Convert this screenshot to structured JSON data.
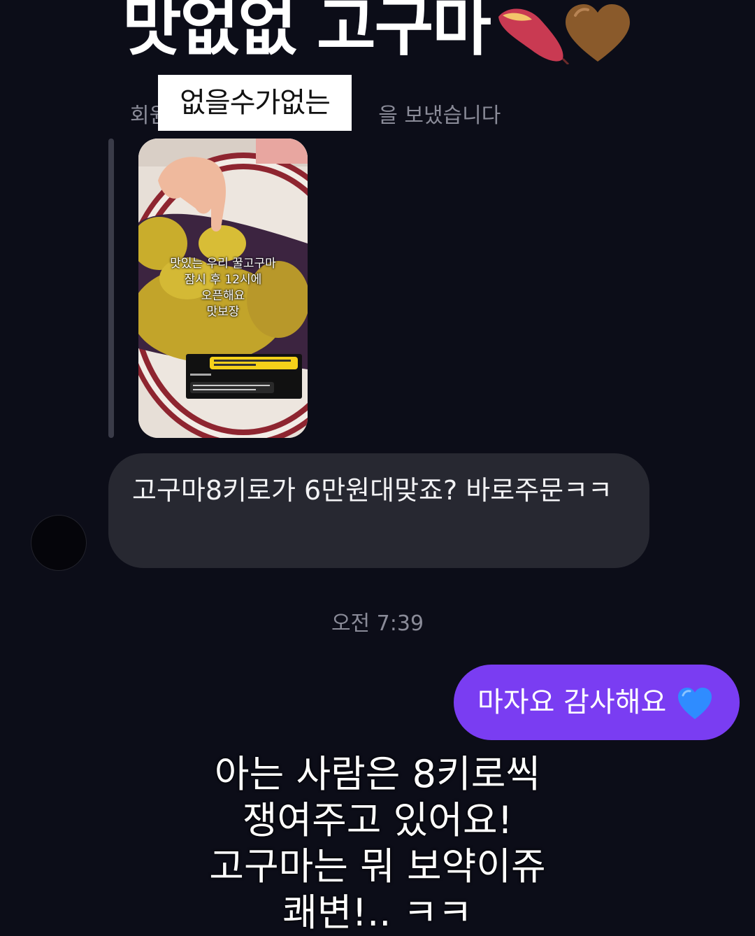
{
  "story_overlay": {
    "title": "맛없없 고구마",
    "sticker": "없을수가없는"
  },
  "reply": {
    "header_start": "회원",
    "header_end": "을 보냈습니다",
    "shared_story_text": [
      "맛있는 우리 꿀고구마",
      "잠시 후 12시에",
      "오픈해요",
      "맛보장"
    ]
  },
  "messages": {
    "incoming": "고구마8키로가 6만원대맞죠? 바로주문ㅋㅋ",
    "timestamp": "오전 7:39",
    "outgoing": "마자요 감사해요"
  },
  "caption": {
    "lines": [
      "아는 사람은 8키로씩",
      "쟁여주고 있어요!",
      "고구마는 뭐 보약이쥬",
      "쾌변!.. ㅋㅋ"
    ]
  },
  "icons": {
    "sweet_potato": "sweet-potato-icon",
    "brown_heart": "brown-heart-icon",
    "blue_heart": "blue-heart-icon"
  },
  "colors": {
    "background": "#0c0d18",
    "incoming_bubble": "#272831",
    "outgoing_bubble": "#7a3df2",
    "brown_heart": "#8a5a2b",
    "blue_heart": "#2f8cff"
  }
}
